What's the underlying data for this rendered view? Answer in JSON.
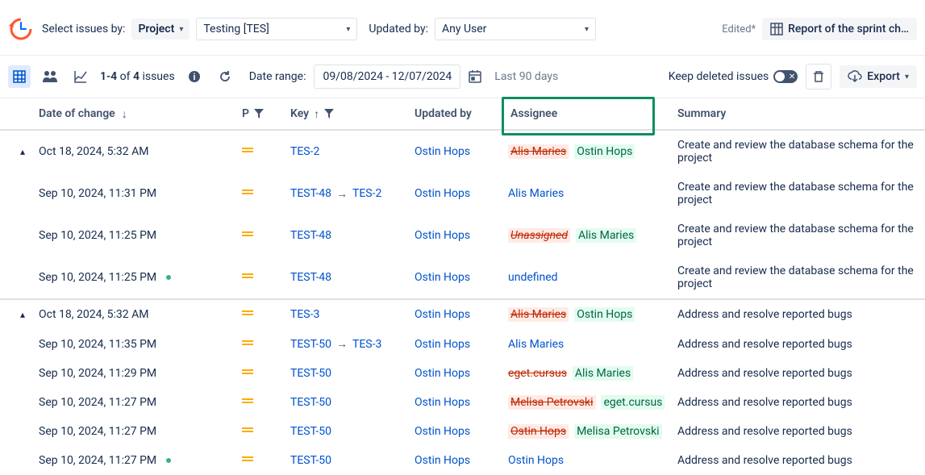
{
  "topbar": {
    "select_label": "Select issues by:",
    "project_dd": "Project",
    "project_val": "Testing [TES]",
    "updated_label": "Updated by:",
    "updated_val": "Any User",
    "edited": "Edited*",
    "report_btn": "Report of the sprint ch…"
  },
  "toolbar": {
    "count_a": "1-4",
    "count_of": "of",
    "count_b": "4",
    "count_word": "issues",
    "date_label": "Date range:",
    "date_val": "09/08/2024 - 12/07/2024",
    "hint": "Last 90 days",
    "keep_del": "Keep deleted issues",
    "export": "Export"
  },
  "headers": {
    "date": "Date of change",
    "p": "P",
    "key": "Key",
    "updated": "Updated by",
    "assignee": "Assignee",
    "summary": "Summary"
  },
  "groups": [
    {
      "rows": [
        {
          "expand": true,
          "date": "Oct 18, 2024, 5:32 AM",
          "dot": false,
          "key": "TES-2",
          "keyFrom": null,
          "updated": "Ostin Hops",
          "oldA": "Alis Maries",
          "oldBg": true,
          "newA": "Ostin Hops",
          "newBg": true,
          "rawA": null,
          "summary": "Create and review the database schema for the project"
        },
        {
          "expand": false,
          "date": "Sep 10, 2024, 11:31 PM",
          "dot": false,
          "key": "TES-2",
          "keyFrom": "TEST-48",
          "updated": "Ostin Hops",
          "oldA": null,
          "newA": null,
          "rawA": "Alis Maries",
          "summary": "Create and review the database schema for the project"
        },
        {
          "expand": false,
          "date": "Sep 10, 2024, 11:25 PM",
          "dot": false,
          "key": "TEST-48",
          "keyFrom": null,
          "updated": "Ostin Hops",
          "oldA": "Unassigned",
          "oldBg": true,
          "italicOld": true,
          "newA": "Alis Maries",
          "newBg": true,
          "rawA": null,
          "summary": "Create and review the database schema for the project"
        },
        {
          "expand": false,
          "date": "Sep 10, 2024, 11:25 PM",
          "dot": true,
          "key": "TEST-48",
          "keyFrom": null,
          "updated": "Ostin Hops",
          "oldA": null,
          "newA": null,
          "rawA": "undefined",
          "summary": "Create and review the database schema for the project"
        }
      ]
    },
    {
      "rows": [
        {
          "expand": true,
          "date": "Oct 18, 2024, 5:32 AM",
          "dot": false,
          "key": "TES-3",
          "keyFrom": null,
          "updated": "Ostin Hops",
          "oldA": "Alis Maries",
          "oldBg": true,
          "newA": "Ostin Hops",
          "newBg": true,
          "rawA": null,
          "summary": "Address and resolve reported bugs"
        },
        {
          "expand": false,
          "date": "Sep 10, 2024, 11:35 PM",
          "dot": false,
          "key": "TES-3",
          "keyFrom": "TEST-50",
          "updated": "Ostin Hops",
          "oldA": null,
          "newA": null,
          "rawA": "Alis Maries",
          "summary": "Address and resolve reported bugs"
        },
        {
          "expand": false,
          "date": "Sep 10, 2024, 11:29 PM",
          "dot": false,
          "key": "TEST-50",
          "keyFrom": null,
          "updated": "Ostin Hops",
          "oldA": "eget.cursus",
          "oldBg": false,
          "newA": "Alis Maries",
          "newBg": true,
          "rawA": null,
          "summary": "Address and resolve reported bugs"
        },
        {
          "expand": false,
          "date": "Sep 10, 2024, 11:27 PM",
          "dot": false,
          "key": "TEST-50",
          "keyFrom": null,
          "updated": "Ostin Hops",
          "oldA": "Melisa Petrovski",
          "oldBg": true,
          "newA": "eget.cursus",
          "newBg": true,
          "rawA": null,
          "summary": "Address and resolve reported bugs"
        },
        {
          "expand": false,
          "date": "Sep 10, 2024, 11:27 PM",
          "dot": false,
          "key": "TEST-50",
          "keyFrom": null,
          "updated": "Ostin Hops",
          "oldA": "Ostin Hops",
          "oldBg": true,
          "newA": "Melisa Petrovski",
          "newBg": true,
          "rawA": null,
          "summary": "Address and resolve reported bugs"
        },
        {
          "expand": false,
          "date": "Sep 10, 2024, 11:27 PM",
          "dot": true,
          "key": "TEST-50",
          "keyFrom": null,
          "updated": "Ostin Hops",
          "oldA": null,
          "newA": null,
          "rawA": "Ostin Hops",
          "summary": "Address and resolve reported bugs"
        }
      ]
    }
  ]
}
